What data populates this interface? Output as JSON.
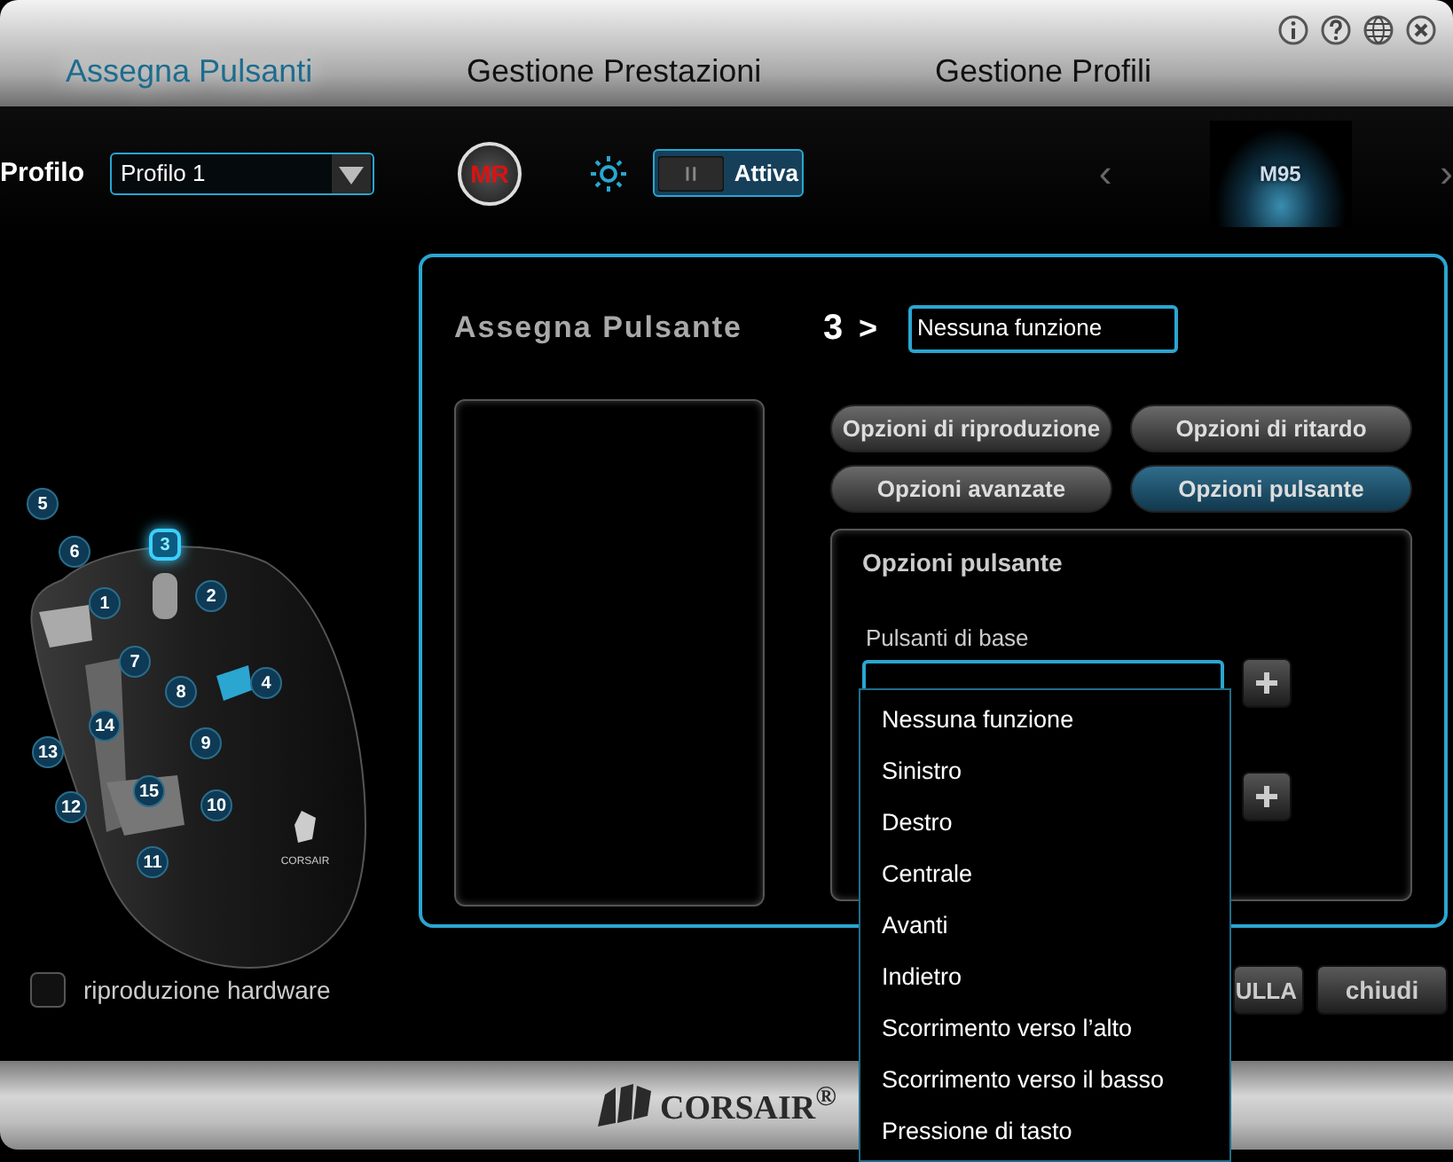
{
  "tabs": [
    {
      "label": "Assegna Pulsanti",
      "selected": true
    },
    {
      "label": "Gestione Prestazioni",
      "selected": false
    },
    {
      "label": "Gestione Profili",
      "selected": false
    }
  ],
  "profile": {
    "label": "Profilo",
    "value": "Profilo 1"
  },
  "macro_record": {
    "label": "MR"
  },
  "lighting_toggle": {
    "label": "Attiva",
    "on": true
  },
  "device": {
    "prev": "‹",
    "name": "M95",
    "next": "›"
  },
  "mouse": {
    "brand": "CORSAIR",
    "buttons": [
      {
        "label": "5",
        "selected": false
      },
      {
        "label": "6",
        "selected": false
      },
      {
        "label": "3",
        "selected": true
      },
      {
        "label": "1",
        "selected": false
      },
      {
        "label": "2",
        "selected": false
      },
      {
        "label": "7",
        "selected": false
      },
      {
        "label": "8",
        "selected": false
      },
      {
        "label": "4",
        "selected": false
      },
      {
        "label": "14",
        "selected": false
      },
      {
        "label": "9",
        "selected": false
      },
      {
        "label": "13",
        "selected": false
      },
      {
        "label": "15",
        "selected": false
      },
      {
        "label": "12",
        "selected": false
      },
      {
        "label": "10",
        "selected": false
      },
      {
        "label": "11",
        "selected": false
      }
    ]
  },
  "hardware_playback": {
    "label": "riproduzione hardware",
    "checked": false
  },
  "assign_panel": {
    "title": "Assegna Pulsante",
    "button_number": "3",
    "arrow": ">",
    "function_value": "Nessuna funzione",
    "option_buttons": [
      {
        "label": "Opzioni di riproduzione",
        "selected": false
      },
      {
        "label": "Opzioni di ritardo",
        "selected": false
      },
      {
        "label": "Opzioni avanzate",
        "selected": false
      },
      {
        "label": "Opzioni pulsante",
        "selected": true
      }
    ],
    "options_title": "Opzioni pulsante",
    "basic_label": "Pulsanti di base"
  },
  "dropdown": [
    {
      "label": "Nessuna funzione",
      "selected": false
    },
    {
      "label": "Sinistro",
      "selected": false
    },
    {
      "label": "Destro",
      "selected": false
    },
    {
      "label": "Centrale",
      "selected": false
    },
    {
      "label": "Avanti",
      "selected": false
    },
    {
      "label": "Indietro",
      "selected": false
    },
    {
      "label": "Scorrimento verso l’alto",
      "selected": false
    },
    {
      "label": "Scorrimento verso il basso",
      "selected": false
    },
    {
      "label": "Pressione di tasto",
      "selected": false
    }
  ],
  "footer_buttons": [
    "ULLA",
    "chiudi"
  ],
  "footer_logo": "CORSAIR$^{®}$"
}
